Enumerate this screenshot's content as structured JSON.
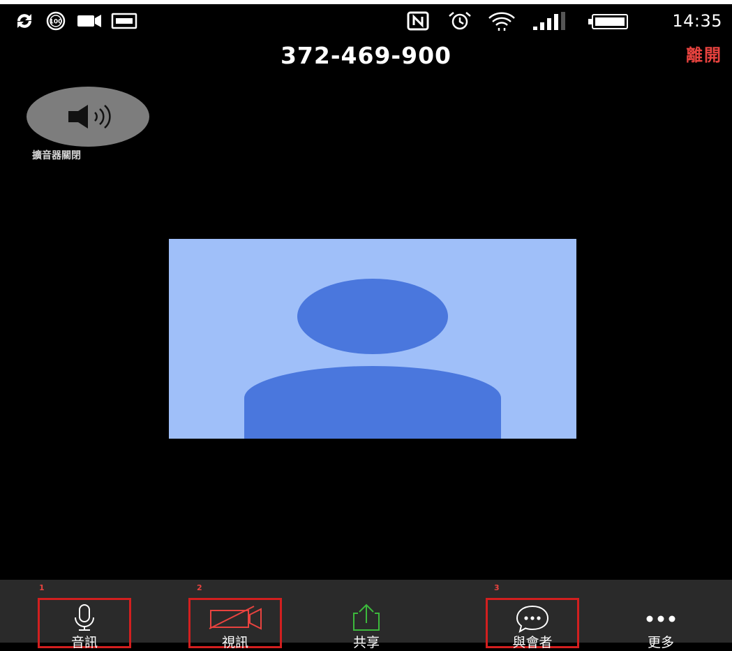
{
  "status_bar": {
    "time": "14:35",
    "icons": [
      "sync-icon",
      "battery-saver-100-icon",
      "video-camera-icon",
      "keyboard-icon",
      "nfc-icon",
      "alarm-icon",
      "wifi-icon",
      "signal-icon",
      "battery-icon"
    ]
  },
  "header": {
    "meeting_id": "372-469-900",
    "leave_label": "離開"
  },
  "speaker": {
    "label": "擴音器關閉"
  },
  "toolbar": {
    "markers": [
      "1",
      "2",
      "3"
    ],
    "buttons": [
      {
        "label": "音訊",
        "icon": "microphone-icon"
      },
      {
        "label": "視訊",
        "icon": "video-off-icon"
      },
      {
        "label": "共享",
        "icon": "share-icon"
      },
      {
        "label": "與會者",
        "icon": "chat-icon"
      },
      {
        "label": "更多",
        "icon": "more-icon"
      }
    ]
  },
  "colors": {
    "background": "#000000",
    "leave": "#e8433f",
    "highlight_box": "#d21f1f",
    "share_accent": "#3cb93c",
    "video_bg": "#9fbff9",
    "avatar": "#4a77dd",
    "speaker_circle": "#7d7d7d"
  }
}
